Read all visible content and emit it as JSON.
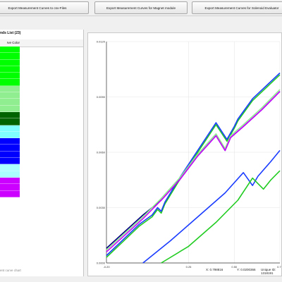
{
  "toolbar": {
    "export_csv_label": "Export Measurement Curves to csv-Files",
    "export_magnet_label": "Export Measurement Curves for Magnet module",
    "export_solenoid_label": "Export Measurement Curves for Solenoid Evaluator"
  },
  "left_panel": {
    "title": "nds List (23)",
    "column_header": "rve Color",
    "swatches": [
      "#00ff00",
      "#00ff00",
      "#00ff00",
      "#00ff00",
      "#00ff00",
      "#00ff00",
      "#90ee90",
      "#90ee90",
      "#90ee90",
      "#90ee90",
      "#006400",
      "#006400",
      "#7fffff",
      "#7fffff",
      "#0000ff",
      "#0000ff",
      "#0000ff",
      "#0000ff",
      "#aaffff",
      "#aaffff",
      "#cc00ff",
      "#cc00ff",
      "#cc00ff"
    ],
    "status_text": "ent curve chart"
  },
  "plot": {
    "x_tick_labels": [
      "-0.20",
      "0.25",
      "0.50",
      "0.75"
    ],
    "y_tick_labels": [
      "0.0000",
      "0.0030",
      "0.0060",
      "0.0090",
      "0.0120"
    ],
    "readout_x": "X: 0.798816",
    "readout_y": "Y: 0.0200366",
    "unique_id": "Unique ID: 1318191"
  },
  "chart_data": {
    "type": "line",
    "title": "",
    "xlabel": "",
    "ylabel": "",
    "x_tick_labels": [
      "-0.20",
      "0.25",
      "0.50",
      "0.75"
    ],
    "y_tick_labels": [
      "0.0000",
      "0.0030",
      "0.0060",
      "0.0090",
      "0.0120"
    ],
    "xlim": [
      -0.2,
      0.75
    ],
    "ylim": [
      0.0,
      0.012
    ],
    "grid": true,
    "series": [
      {
        "color": "#22cc22",
        "x": [
          -0.2,
          -0.02,
          0.05,
          0.08,
          0.1,
          0.12,
          0.2,
          0.4,
          0.46,
          0.5,
          0.52,
          0.6,
          0.75
        ],
        "y": [
          0.0003,
          0.002,
          0.0025,
          0.0029,
          0.0027,
          0.0032,
          0.0045,
          0.0075,
          0.0066,
          0.0073,
          0.0077,
          0.0088,
          0.0102
        ]
      },
      {
        "color": "#1a3cff",
        "x": [
          -0.2,
          -0.02,
          0.05,
          0.08,
          0.1,
          0.12,
          0.2,
          0.4,
          0.46,
          0.5,
          0.52,
          0.6,
          0.75
        ],
        "y": [
          0.0004,
          0.0021,
          0.0026,
          0.003,
          0.0028,
          0.0033,
          0.0046,
          0.0076,
          0.0067,
          0.0074,
          0.0078,
          0.0089,
          0.0103
        ]
      },
      {
        "color": "#000080",
        "x": [
          -0.2,
          0.0,
          0.1,
          0.2,
          0.3,
          0.4,
          0.45,
          0.48,
          0.55,
          0.65,
          0.75
        ],
        "y": [
          0.0008,
          0.0026,
          0.0034,
          0.0045,
          0.0058,
          0.0069,
          0.0061,
          0.0068,
          0.0074,
          0.0083,
          0.0093
        ]
      },
      {
        "color": "#90ee90",
        "x": [
          -0.2,
          0.0,
          0.1,
          0.2,
          0.3,
          0.4,
          0.45,
          0.48,
          0.55,
          0.65,
          0.75
        ],
        "y": [
          0.0007,
          0.0025,
          0.0035,
          0.0046,
          0.0059,
          0.007,
          0.0062,
          0.0069,
          0.0075,
          0.0084,
          0.0094
        ]
      },
      {
        "color": "#cc00ff",
        "x": [
          -0.2,
          0.0,
          0.1,
          0.2,
          0.3,
          0.4,
          0.45,
          0.48,
          0.55,
          0.65,
          0.75
        ],
        "y": [
          0.0006,
          0.0024,
          0.0034,
          0.0045,
          0.0058,
          0.0069,
          0.0061,
          0.0068,
          0.0074,
          0.0083,
          0.0093
        ]
      },
      {
        "color": "#1a3cff",
        "x": [
          0.0,
          0.15,
          0.3,
          0.45,
          0.55,
          0.6,
          0.63,
          0.7,
          0.75
        ],
        "y": [
          0.0,
          0.0012,
          0.0025,
          0.0038,
          0.0049,
          0.0042,
          0.0047,
          0.0055,
          0.0061
        ]
      },
      {
        "color": "#22cc22",
        "x": [
          0.1,
          0.25,
          0.4,
          0.52,
          0.6,
          0.66,
          0.7,
          0.75
        ],
        "y": [
          0.0,
          0.0009,
          0.0022,
          0.0034,
          0.0046,
          0.004,
          0.0045,
          0.005
        ]
      }
    ]
  }
}
